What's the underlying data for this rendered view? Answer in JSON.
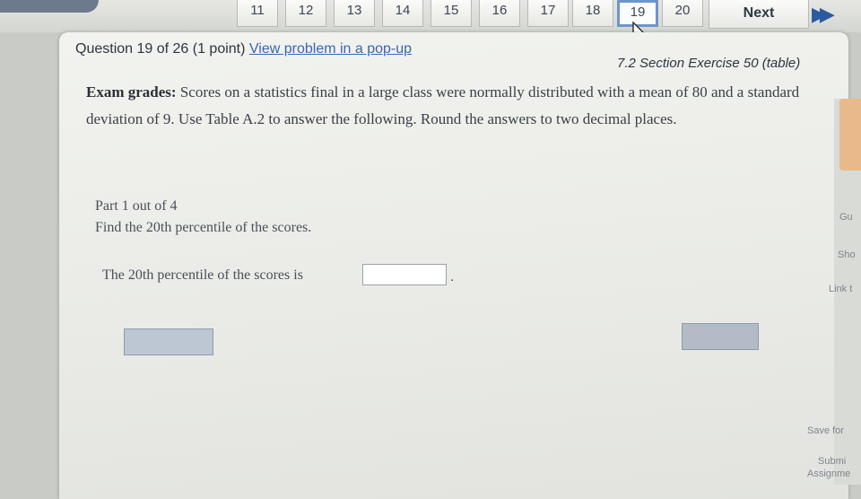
{
  "nav": {
    "numbers": [
      "11",
      "12",
      "13",
      "14",
      "15",
      "16",
      "17",
      "18",
      "19",
      "20"
    ],
    "current": "19",
    "next_label": "Next"
  },
  "question": {
    "header": "Question 19 of 26 (1 point)",
    "popup_link": "View problem in a pop-up",
    "section": "7.2 Section Exercise 50 (table)",
    "title": "Exam grades:",
    "text": "Scores on a statistics final in a large class were normally distributed with a mean of 80 and a standard deviation of 9. Use Table A.2 to answer the following. Round the answers to two decimal places.",
    "part": "Part 1 out of 4",
    "prompt": "Find the 20th percentile of the scores.",
    "answer_label": "The 20th percentile of the scores is",
    "answer_value": "",
    "answer_suffix": "."
  },
  "side": {
    "items": [
      "Gu",
      "Sho",
      "Link t",
      "Save for",
      "Submi",
      "Assignme"
    ]
  },
  "colors": {
    "accent": "#3569b0",
    "current_border": "#6f95c9",
    "side_accent": "#e9b98c"
  }
}
